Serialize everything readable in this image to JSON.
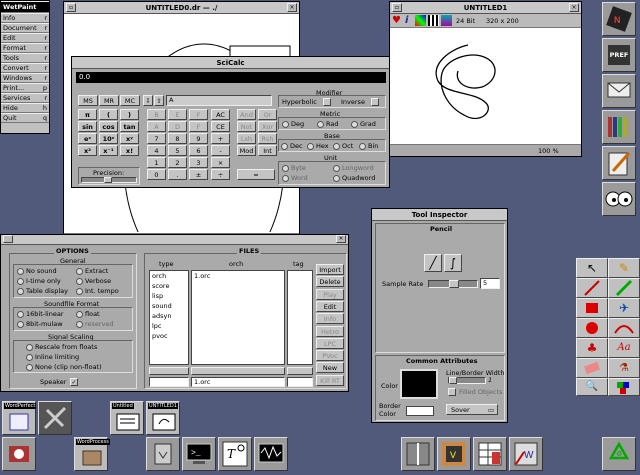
{
  "menu": {
    "title": "WetPaint",
    "items": [
      {
        "label": "Info",
        "key": "r"
      },
      {
        "label": "Document",
        "key": "r"
      },
      {
        "label": "Edit",
        "key": "r"
      },
      {
        "label": "Format",
        "key": "r"
      },
      {
        "label": "Tools",
        "key": "r"
      },
      {
        "label": "Convert",
        "key": "r"
      },
      {
        "label": "Windows",
        "key": "r"
      },
      {
        "label": "Print...",
        "key": "p"
      },
      {
        "label": "Services",
        "key": "r"
      },
      {
        "label": "Hide",
        "key": "h"
      },
      {
        "label": "Quit",
        "key": "q"
      }
    ]
  },
  "drawing_window": {
    "title": "UNTITLED0.dr — ./"
  },
  "paint_window": {
    "title": "UNTITLED1",
    "depth": "24 Bit",
    "size": "320 x 200",
    "zoom": "100 %"
  },
  "scicalc": {
    "title": "SciCalc",
    "display": "0.0",
    "mem": [
      "MS",
      "MR",
      "MC"
    ],
    "mode_label": "A",
    "keys": [
      [
        "π",
        "(",
        ")",
        "B",
        "E",
        "F",
        "AC",
        "And",
        "Or"
      ],
      [
        "sin",
        "cos",
        "tan",
        "A",
        "D",
        "F",
        "CE",
        "Not",
        "Xor"
      ],
      [
        "eˣ",
        "10ˣ",
        "xʸ",
        "7",
        "8",
        "9",
        "+",
        "Lsh",
        "Rsh"
      ],
      [
        "x²",
        "x⁻¹",
        "x!",
        "4",
        "5",
        "6",
        "-",
        "Mod",
        "Int"
      ],
      [
        "",
        "",
        "",
        "1",
        "2",
        "3",
        "×",
        "",
        ""
      ],
      [
        "",
        "",
        "",
        "0",
        ".",
        "±",
        "÷",
        "=",
        ""
      ]
    ],
    "precision_label": "Precision:",
    "precision_value": "8",
    "modifier": {
      "title": "Modifier",
      "hyperbolic": "Hyperbolic",
      "inverse": "Inverse"
    },
    "metric": {
      "title": "Metric",
      "options": [
        "Deg",
        "Rad",
        "Grad"
      ]
    },
    "base": {
      "title": "Base",
      "options": [
        "Dec",
        "Hex",
        "Oct",
        "Bin"
      ]
    },
    "unit": {
      "title": "Unit",
      "options": [
        "Byte",
        "Longword",
        "Word",
        "Quadword"
      ]
    }
  },
  "options": {
    "title": "OPTIONS",
    "general_title": "General",
    "general": [
      "No sound",
      "Extract",
      "I-time only",
      "Verbose",
      "Table display",
      "Int. tempo"
    ],
    "soundfile_title": "Soundfile Format",
    "soundfile": [
      "16bit-linear",
      "float",
      "8bit-mulaw",
      "reserved"
    ],
    "scaling_title": "Signal Scaling",
    "scaling": [
      "Rescale from floats",
      "Inline limiting",
      "None (clip non-float)"
    ],
    "speaker": "Speaker"
  },
  "files": {
    "title": "FILES",
    "col_type": "type",
    "col_orch": "orch",
    "col_tag": "tag",
    "types": [
      "orch",
      "score",
      "lisp",
      "sound",
      "adsyn",
      "lpc",
      "pvoc"
    ],
    "orch_items": [
      "1.orc"
    ],
    "orch_field": "1.orc",
    "buttons": [
      "Import",
      "Delete",
      "Play",
      "Edit",
      "Info",
      "Hetro",
      "LPC",
      "PVoc",
      "New",
      "Kill RT"
    ]
  },
  "tool_inspector": {
    "title": "Tool Inspector",
    "tool": "Pencil",
    "sample_rate_label": "Sample Rate",
    "sample_rate": "5",
    "common_title": "Common Attributes",
    "color_label": "Color",
    "line_width_label": "Line/Border Width",
    "line_width": "1",
    "filled": "Filled Objects",
    "border_color_label": "Border Color",
    "mode": "Sover"
  },
  "dock": {
    "pref_label": "PREF"
  },
  "shelf": {
    "wordperfect": "WordPerfect",
    "untitled": "Untitled",
    "untitled1": "UNTITLED1",
    "wordprocess": "WordProcess"
  },
  "colors": {
    "desktop": "#525a7b",
    "panel": "#aaaaaa",
    "titlebar": "#000000"
  }
}
